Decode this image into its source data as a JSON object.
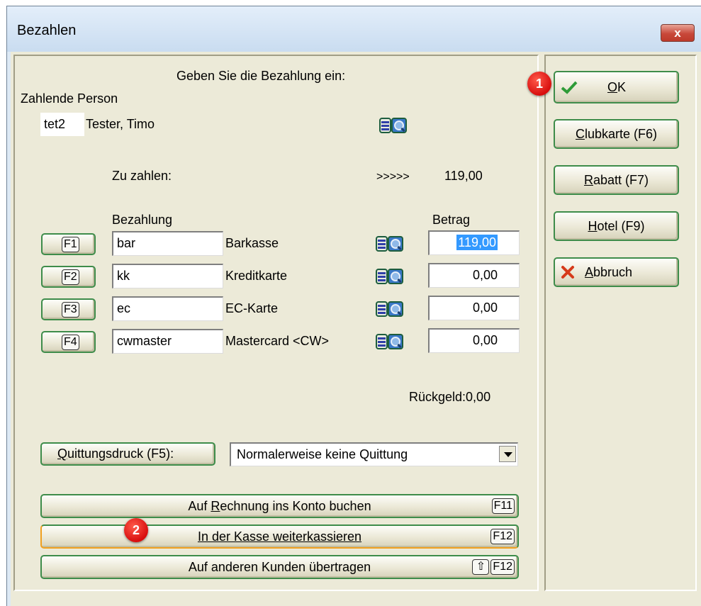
{
  "window": {
    "title": "Bezahlen",
    "close_label": "x"
  },
  "header": {
    "prompt": "Geben Sie die Bezahlung ein:"
  },
  "payer": {
    "label": "Zahlende Person",
    "code": "tet2",
    "name": "Tester, Timo"
  },
  "due": {
    "label": "Zu zahlen:",
    "arrows": ">>>>>",
    "amount": "119,00"
  },
  "payments": {
    "col_method": "Bezahlung",
    "col_amount": "Betrag",
    "rows": [
      {
        "key": "F1",
        "code": "bar",
        "name": "Barkasse",
        "amount": "119,00",
        "selected": true
      },
      {
        "key": "F2",
        "code": "kk",
        "name": "Kreditkarte",
        "amount": "0,00",
        "selected": false
      },
      {
        "key": "F3",
        "code": "ec",
        "name": "EC-Karte",
        "amount": "0,00",
        "selected": false
      },
      {
        "key": "F4",
        "code": "cwmaster",
        "name": "Mastercard <CW>",
        "amount": "0,00",
        "selected": false
      }
    ]
  },
  "change": {
    "text": "Rückgeld:0,00"
  },
  "receipt": {
    "button_mn": "Q",
    "button_rest": "uittungsdruck (F5):",
    "selected": "Normalerweise keine Quittung"
  },
  "actions": [
    {
      "pre": "Auf ",
      "mn": "R",
      "post": "echnung ins Konto buchen",
      "keys": [
        "F11"
      ]
    },
    {
      "pre": "",
      "mn": "I",
      "post": "n der Kasse weiterkassieren",
      "keys": [
        "F12"
      ]
    },
    {
      "pre": "Auf anderen Kunden übertragen",
      "mn": "",
      "post": "",
      "keys": [
        "⇧",
        "F12"
      ]
    }
  ],
  "side": {
    "ok": {
      "mn": "O",
      "rest": "K"
    },
    "clubkarte": {
      "mn": "C",
      "rest": "lubkarte (F6)"
    },
    "rabatt": {
      "mn": "R",
      "rest": "abatt (F7)"
    },
    "hotel": {
      "mn": "H",
      "rest": "otel (F9)"
    },
    "abbruch": {
      "mn": "A",
      "rest": "bbruch"
    }
  },
  "badges": {
    "one": "1",
    "two": "2"
  },
  "colors": {
    "dialog_bg": "#ecead8",
    "button_border": "#3e8c4a",
    "selection": "#3399ff",
    "badge": "#d80e0e"
  }
}
